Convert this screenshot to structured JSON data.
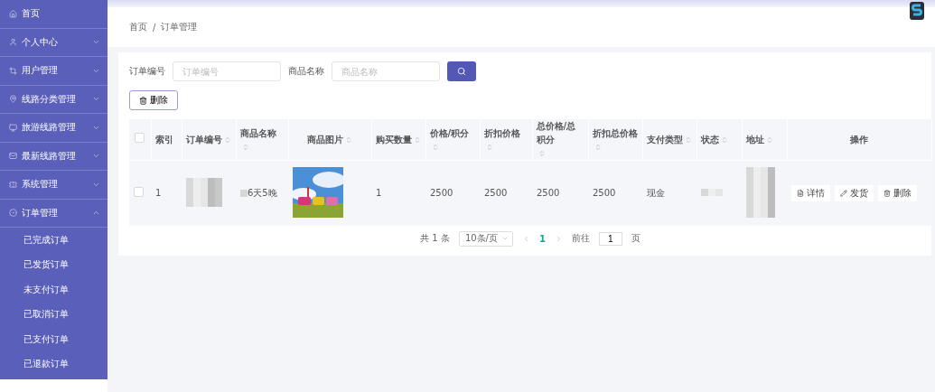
{
  "sidebar": {
    "items": [
      {
        "label": "首页"
      },
      {
        "label": "个人中心",
        "expanded": false
      },
      {
        "label": "用户管理",
        "expanded": false
      },
      {
        "label": "线路分类管理",
        "expanded": false
      },
      {
        "label": "旅游线路管理",
        "expanded": false
      },
      {
        "label": "最新线路管理",
        "expanded": false
      },
      {
        "label": "系统管理",
        "expanded": false
      },
      {
        "label": "订单管理",
        "expanded": true,
        "children": [
          {
            "label": "已完成订单"
          },
          {
            "label": "已发货订单"
          },
          {
            "label": "未支付订单"
          },
          {
            "label": "已取消订单"
          },
          {
            "label": "已支付订单"
          },
          {
            "label": "已退款订单"
          }
        ]
      }
    ]
  },
  "breadcrumb": [
    "首页",
    "订单管理"
  ],
  "breadcrumb_separator": "/",
  "search": {
    "fields": [
      {
        "label": "订单编号",
        "placeholder": "订单编号"
      },
      {
        "label": "商品名称",
        "placeholder": "商品名称"
      }
    ]
  },
  "delete_button": "删除",
  "table": {
    "all_checked": false,
    "columns": [
      {
        "label": "索引",
        "sortable": false
      },
      {
        "label": "订单编号",
        "sortable": true
      },
      {
        "label": "商品名称",
        "sortable": true
      },
      {
        "label": "商品图片",
        "sortable": true
      },
      {
        "label": "购买数量",
        "sortable": true
      },
      {
        "label": "价格/积分",
        "sortable": true
      },
      {
        "label": "折扣价格",
        "sortable": true
      },
      {
        "label": "总价格/总积分",
        "sortable": true
      },
      {
        "label": "折扣总价格",
        "sortable": true
      },
      {
        "label": "支付类型",
        "sortable": true
      },
      {
        "label": "状态",
        "sortable": true
      },
      {
        "label": "地址",
        "sortable": true
      },
      {
        "label": "操作",
        "sortable": false
      }
    ],
    "rows": [
      {
        "checked": false,
        "index": "1",
        "product_name": "6天5晚",
        "quantity": "1",
        "price": "2500",
        "discount_price": "2500",
        "total_price": "2500",
        "discount_total": "2500",
        "payment_type": "现金",
        "actions": [
          "详情",
          "发货",
          "删除"
        ]
      }
    ]
  },
  "pagination": {
    "total": "共 1 条",
    "page_size": "10条/页",
    "pages": [
      {
        "label": "1",
        "selected": true
      }
    ],
    "goto_label": "前往",
    "goto_value": "1",
    "page_unit": "页"
  }
}
